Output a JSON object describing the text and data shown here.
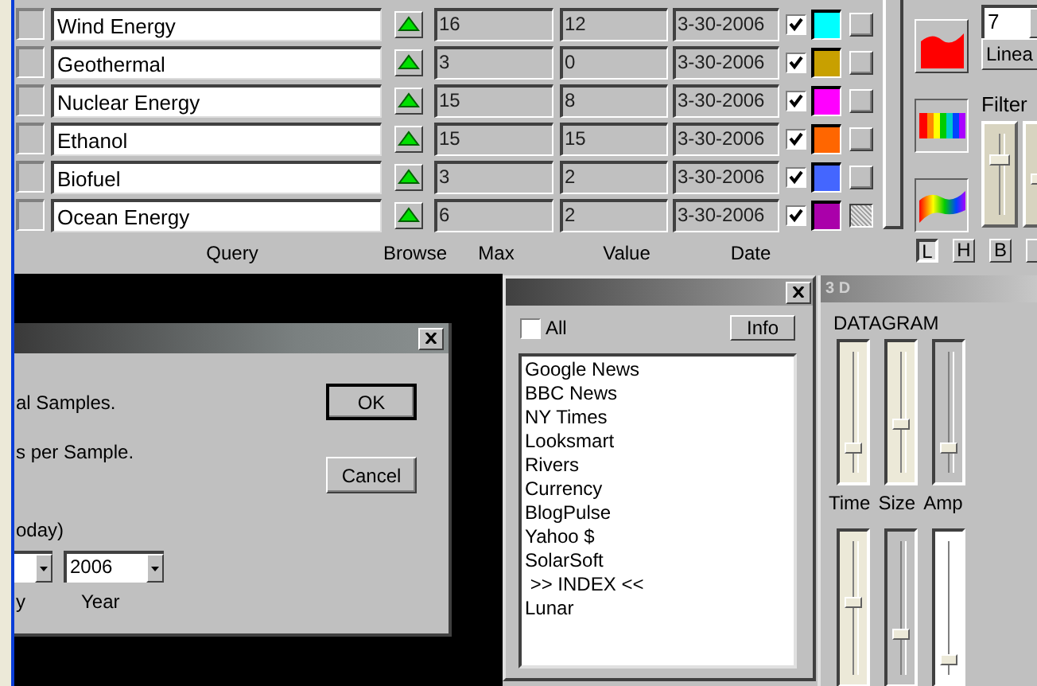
{
  "queries": {
    "rows": [
      {
        "query": "Wind Energy",
        "max": "16",
        "value": "12",
        "date": "3-30-2006",
        "checked": true,
        "color": "#00ffff",
        "pressed": false
      },
      {
        "query": "Geothermal",
        "max": "3",
        "value": "0",
        "date": "3-30-2006",
        "checked": true,
        "color": "#c8a000",
        "pressed": false
      },
      {
        "query": "Nuclear Energy",
        "max": "15",
        "value": "8",
        "date": "3-30-2006",
        "checked": true,
        "color": "#ff00ff",
        "pressed": false
      },
      {
        "query": "Ethanol",
        "max": "15",
        "value": "15",
        "date": "3-30-2006",
        "checked": true,
        "color": "#ff6600",
        "pressed": false
      },
      {
        "query": "Biofuel",
        "max": "3",
        "value": "2",
        "date": "3-30-2006",
        "checked": true,
        "color": "#4466ff",
        "pressed": false
      },
      {
        "query": "Ocean Energy",
        "max": "6",
        "value": "2",
        "date": "3-30-2006",
        "checked": true,
        "color": "#aa00aa",
        "pressed": true
      }
    ],
    "columns": [
      "Query",
      "Browse",
      "Max",
      "Value",
      "Date"
    ]
  },
  "display": {
    "styles": [
      {
        "kind": "area",
        "selected": false
      },
      {
        "kind": "spectrum",
        "selected": true
      },
      {
        "kind": "wave",
        "selected": true
      }
    ],
    "spin": {
      "value": "7"
    },
    "scale_button": "Linea",
    "filter": {
      "label": "Filter",
      "sliders": [
        {
          "level": 0.7
        },
        {
          "level": 0.45
        }
      ]
    },
    "modes": [
      {
        "label": "L",
        "selected": true
      },
      {
        "label": "H",
        "selected": false
      },
      {
        "label": "B",
        "selected": false
      }
    ]
  },
  "dialog": {
    "lines": [
      "al Samples.",
      "s per Sample.",
      "oday)"
    ],
    "year": "2006",
    "labels": [
      "y",
      "Year"
    ],
    "buttons": [
      "OK",
      "Cancel"
    ]
  },
  "sources": {
    "all": {
      "label": "All",
      "checked": false
    },
    "info": "Info",
    "items": [
      "Google News",
      "BBC News",
      "NY Times",
      "Looksmart",
      "Rivers",
      "Currency",
      "BlogPulse",
      "Yahoo $",
      "SolarSoft",
      " >> INDEX <<",
      "Lunar"
    ]
  },
  "datagram": {
    "title": "3 D",
    "heading": "DATAGRAM",
    "sliders": [
      {
        "label": "Time",
        "level": 0.2,
        "color": "#ece9d8"
      },
      {
        "label": "Size",
        "level": 0.4,
        "color": "#ece9d8"
      },
      {
        "label": "Amp",
        "level": 0.2,
        "color": "#c0c0c0"
      }
    ],
    "lower_sliders": [
      {
        "level": 0.55,
        "color": "#ece9d8"
      },
      {
        "level": 0.3,
        "color": "#c0c0c0"
      },
      {
        "level": 0.1,
        "color": "#ffffff"
      }
    ]
  }
}
